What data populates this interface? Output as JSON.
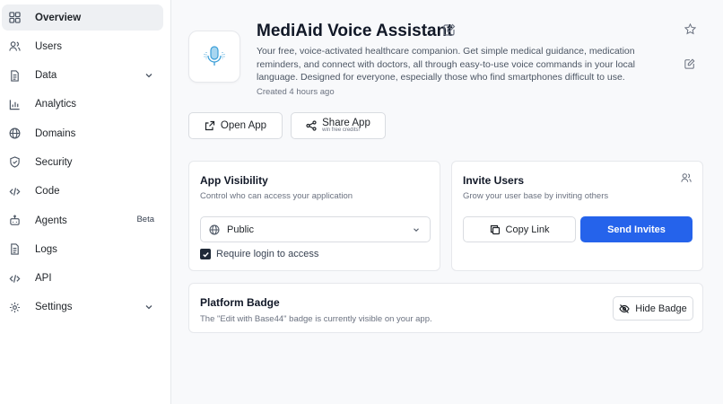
{
  "sidebar": {
    "items": [
      {
        "label": "Overview",
        "icon": "grid-icon",
        "active": true
      },
      {
        "label": "Users",
        "icon": "users-icon"
      },
      {
        "label": "Data",
        "icon": "document-icon",
        "has_chevron": true
      },
      {
        "label": "Analytics",
        "icon": "bar-chart-icon"
      },
      {
        "label": "Domains",
        "icon": "globe-icon"
      },
      {
        "label": "Security",
        "icon": "shield-icon"
      },
      {
        "label": "Code",
        "icon": "code-icon"
      },
      {
        "label": "Agents",
        "icon": "bot-icon",
        "badge": "Beta"
      },
      {
        "label": "Logs",
        "icon": "document-icon"
      },
      {
        "label": "API",
        "icon": "code-icon"
      },
      {
        "label": "Settings",
        "icon": "gear-icon",
        "has_chevron": true
      }
    ]
  },
  "app": {
    "title": "MediAid Voice Assistant",
    "description": "Your free, voice-activated healthcare companion. Get simple medical guidance, medication reminders, and connect with doctors, all through easy-to-use voice commands in your local language. Designed for everyone, especially those who find smartphones difficult to use.",
    "created": "Created 4 hours ago",
    "icon": "microphone-icon"
  },
  "actions": {
    "open_label": "Open App",
    "share_label": "Share App",
    "share_sub": "win free credits!"
  },
  "visibility": {
    "title": "App Visibility",
    "subtitle": "Control who can access your application",
    "selected": "Public",
    "require_login_label": "Require login to access",
    "require_login_checked": true
  },
  "invite": {
    "title": "Invite Users",
    "subtitle": "Grow your user base by inviting others",
    "copy_label": "Copy Link",
    "send_label": "Send Invites"
  },
  "badge": {
    "title": "Platform Badge",
    "subtitle": "The \"Edit with Base44\" badge is currently visible on your app.",
    "hide_label": "Hide Badge"
  },
  "colors": {
    "primary": "#2563eb",
    "active_bg": "#eef0f3",
    "mic_accent": "#3b9fd8"
  }
}
